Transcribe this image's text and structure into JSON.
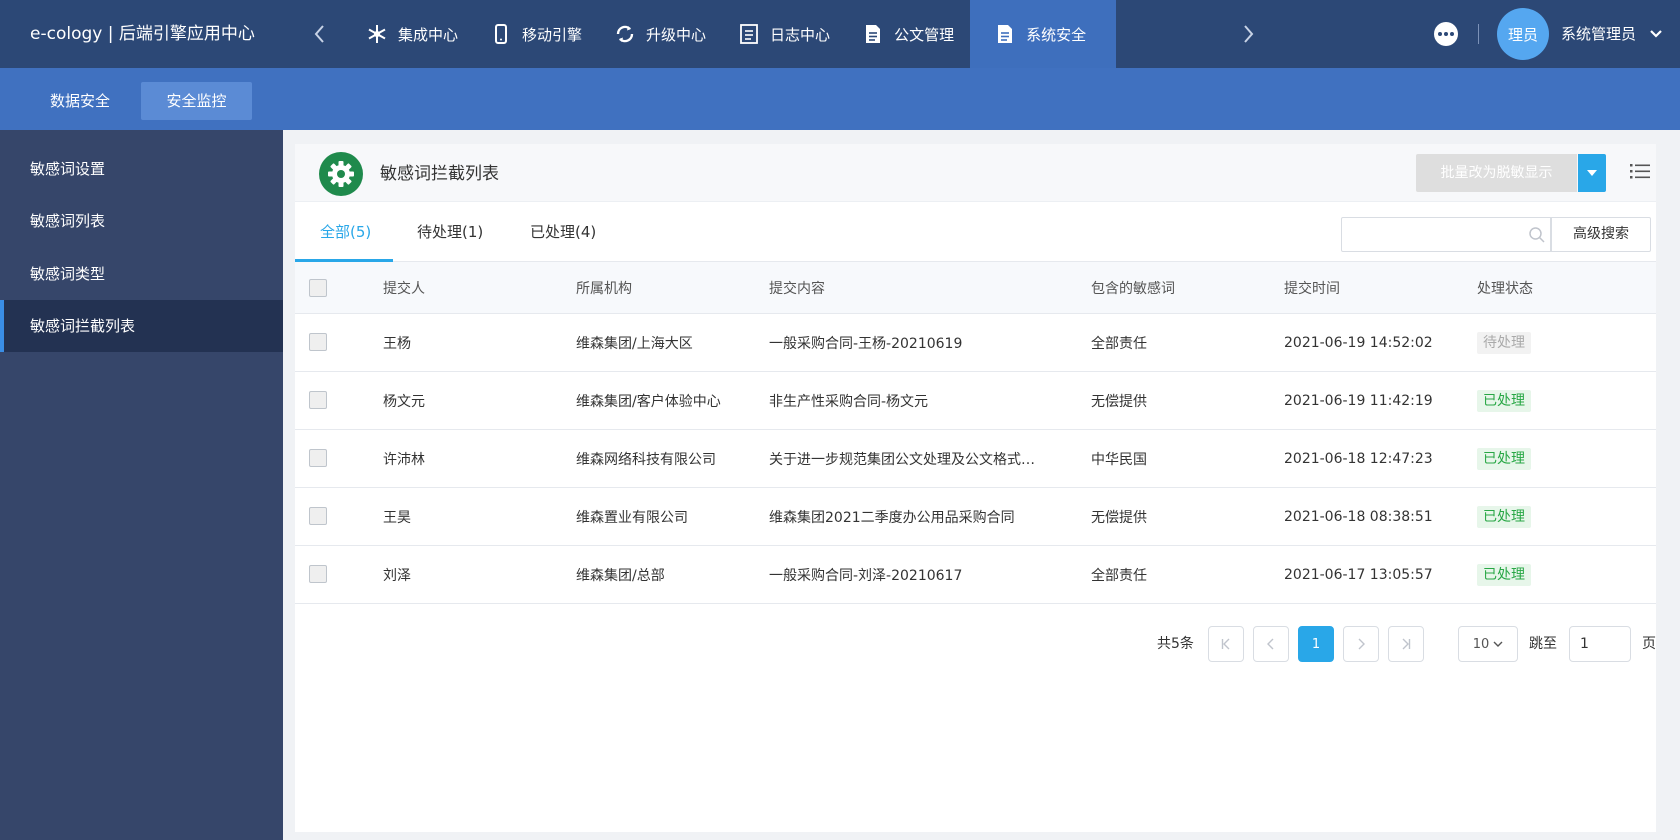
{
  "app": {
    "title": "e-cology | 后端引擎应用中心"
  },
  "nav": {
    "tabs": [
      {
        "label": "集成中心",
        "icon": "snowflake-icon"
      },
      {
        "label": "移动引擎",
        "icon": "phone-icon"
      },
      {
        "label": "升级中心",
        "icon": "refresh-icon"
      },
      {
        "label": "日志中心",
        "icon": "log-icon"
      },
      {
        "label": "公文管理",
        "icon": "document-icon"
      },
      {
        "label": "系统安全",
        "icon": "file-icon",
        "active": true
      }
    ]
  },
  "user": {
    "avatar_text": "理员",
    "name": "系统管理员"
  },
  "subnav": {
    "items": [
      "数据安全",
      "安全监控"
    ],
    "active": "安全监控"
  },
  "sidebar": {
    "items": [
      "敏感词设置",
      "敏感词列表",
      "敏感词类型",
      "敏感词拦截列表"
    ],
    "active": "敏感词拦截列表"
  },
  "panel": {
    "title": "敏感词拦截列表",
    "batch_label": "批量改为脱敏显示"
  },
  "filter_tabs": [
    {
      "label": "全部(5)",
      "active": true
    },
    {
      "label": "待处理(1)"
    },
    {
      "label": "已处理(4)"
    }
  ],
  "search": {
    "value": "",
    "advanced_label": "高级搜索"
  },
  "table": {
    "columns": [
      "提交人",
      "所属机构",
      "提交内容",
      "包含的敏感词",
      "提交时间",
      "处理状态"
    ],
    "rows": [
      [
        "王杨",
        "维森集团/上海大区",
        "一般采购合同-王杨-20210619",
        "全部责任",
        "2021-06-19 14:52:02",
        "待处理"
      ],
      [
        "杨文元",
        "维森集团/客户体验中心",
        "非生产性采购合同-杨文元",
        "无偿提供",
        "2021-06-19 11:42:19",
        "已处理"
      ],
      [
        "许沛林",
        "维森网络科技有限公司",
        "关于进一步规范集团公文处理及公文格式…",
        "中华民国",
        "2021-06-18 12:47:23",
        "已处理"
      ],
      [
        "王昊",
        "维森置业有限公司",
        "维森集团2021二季度办公用品采购合同",
        "无偿提供",
        "2021-06-18 08:38:51",
        "已处理"
      ],
      [
        "刘泽",
        "维森集团/总部",
        "一般采购合同-刘泽-20210617",
        "全部责任",
        "2021-06-17 13:05:57",
        "已处理"
      ]
    ]
  },
  "pagination": {
    "total": "共5条",
    "current": "1",
    "page_size": "10",
    "jump_label": "跳至",
    "jump_value": "1",
    "page_unit": "页"
  },
  "colors": {
    "topbar": "#2c4876",
    "subbar": "#4071c0",
    "sidebar": "#36466a",
    "accent": "#29a7e8",
    "gear_badge": "#1f8a4c",
    "status_done": "#28a745"
  }
}
